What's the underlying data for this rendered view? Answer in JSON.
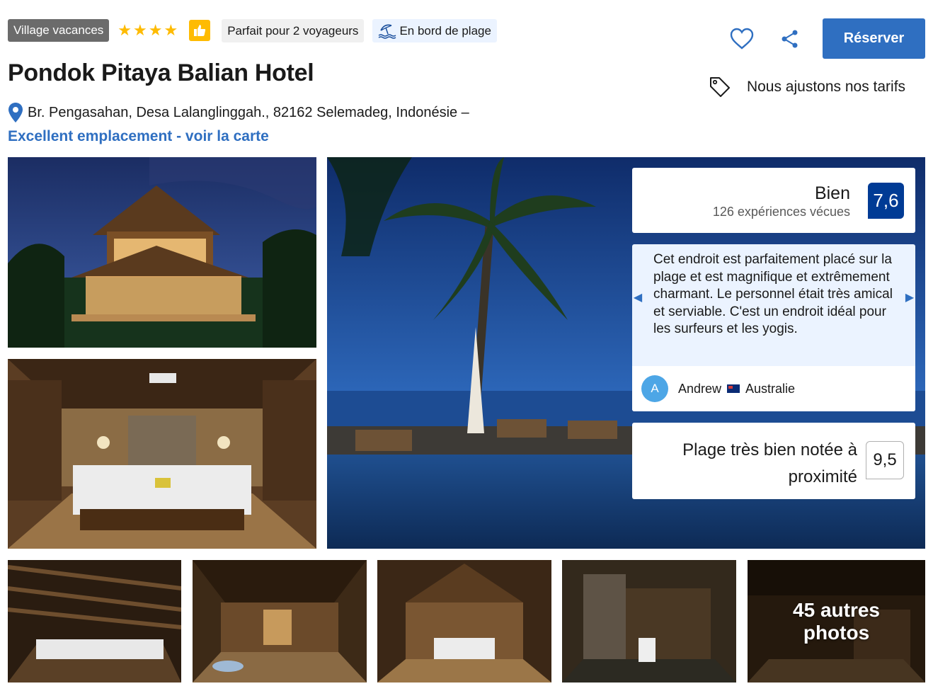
{
  "header": {
    "type_badge": "Village vacances",
    "stars": 4,
    "pill_travelers": "Parfait pour 2 voyageurs",
    "pill_beach": "En bord de plage",
    "reserve_label": "Réserver",
    "price_note": "Nous ajustons nos tarifs"
  },
  "hotel": {
    "name": "Pondok Pitaya Balian Hotel",
    "address": "Br. Pengasahan, Desa Lalanglinggah., 82162 Selemadeg, Indonésie –",
    "map_link": "Excellent emplacement - voir la carte"
  },
  "review": {
    "rating_label": "Bien",
    "count_label": "126 expériences vécues",
    "score": "7,6",
    "quote": "Cet endroit est parfaitement placé sur la plage et est magnifique et extrêmement charmant. Le personnel était très amical et serviable. C'est un endroit idéal pour les surfeurs et les yogis.",
    "author_initial": "A",
    "author_name": "Andrew",
    "author_country": "Australie",
    "beach_label": "Plage très bien notée à proximité",
    "beach_score": "9,5"
  },
  "gallery": {
    "more_line1": "45 autres",
    "more_line2": "photos"
  },
  "colors": {
    "brand_blue": "#2f6fc1",
    "score_dark_blue": "#003b95",
    "star_yellow": "#febb02"
  }
}
